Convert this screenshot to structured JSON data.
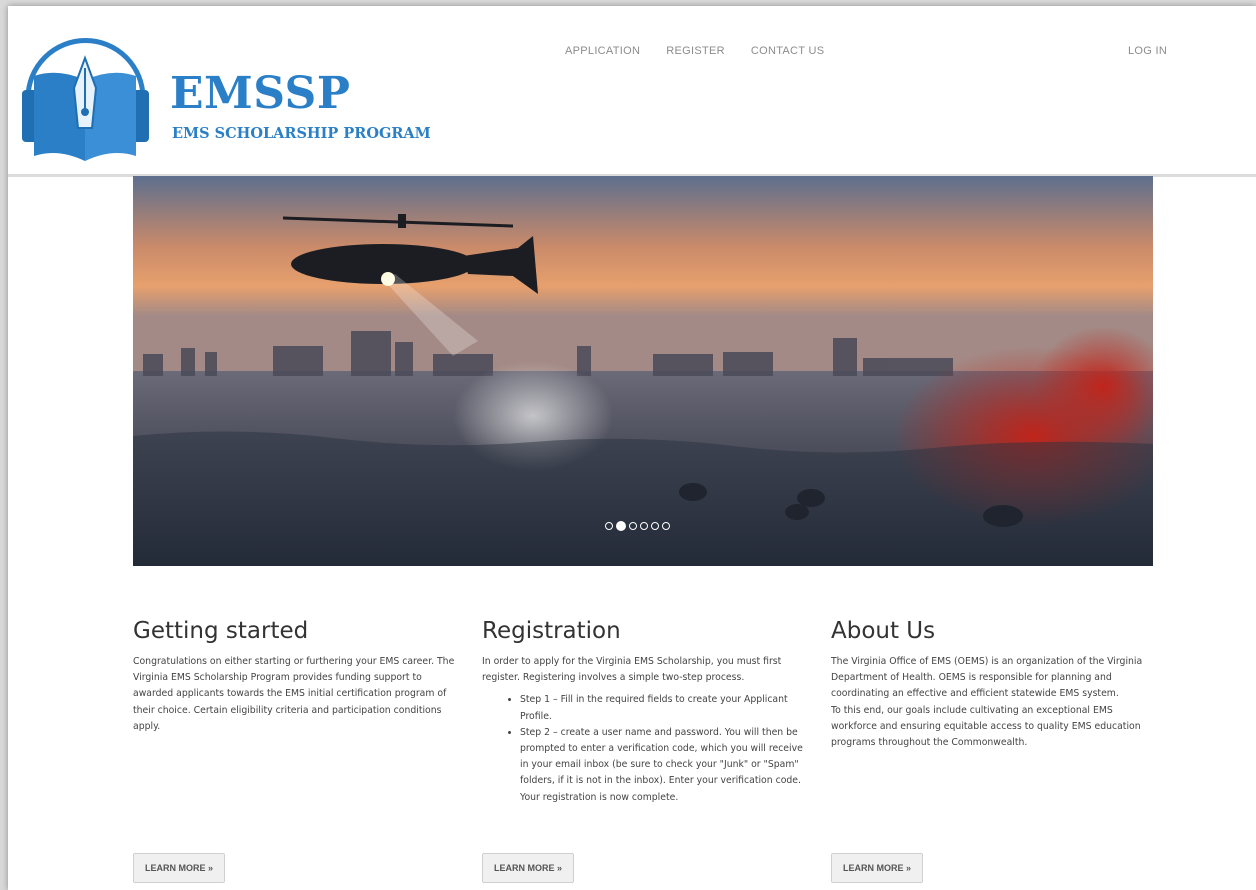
{
  "brand": {
    "title": "EMSSP",
    "subtitle": "EMS SCHOLARSHIP PROGRAM"
  },
  "nav": {
    "items": [
      "APPLICATION",
      "REGISTER",
      "CONTACT US"
    ],
    "login": "LOG IN"
  },
  "carousel": {
    "slide_count": 6,
    "active_index": 1
  },
  "sections": [
    {
      "title": "Getting started",
      "body": "Congratulations on either starting or furthering your EMS career. The Virginia EMS Scholarship Program provides funding support to awarded applicants towards the EMS initial certification program of their choice. Certain eligibility criteria and participation conditions apply.",
      "button": "LEARN MORE »"
    },
    {
      "title": "Registration",
      "body": "In order to apply for the Virginia EMS Scholarship, you must first register. Registering involves a simple two-step process.",
      "steps": [
        "Step 1 – Fill in the required fields to create your Applicant Profile.",
        "Step 2 – create a user name and password. You will then be prompted to enter a verification code, which you will receive in your email inbox (be sure to check your \"Junk\" or \"Spam\" folders, if it is not in the inbox). Enter your verification code. Your registration is now complete."
      ],
      "button": "LEARN MORE »"
    },
    {
      "title": "About Us",
      "body": "The Virginia Office of EMS (OEMS) is an organization of the Virginia Department of Health. OEMS is responsible for planning and coordinating an effective and efficient statewide EMS system.",
      "body2": "To this end, our goals include cultivating an exceptional EMS workforce and ensuring equitable access to quality EMS education programs throughout the Commonwealth.",
      "button": "LEARN MORE »"
    }
  ],
  "colors": {
    "brand": "#2a7fc7",
    "text": "#444444"
  }
}
